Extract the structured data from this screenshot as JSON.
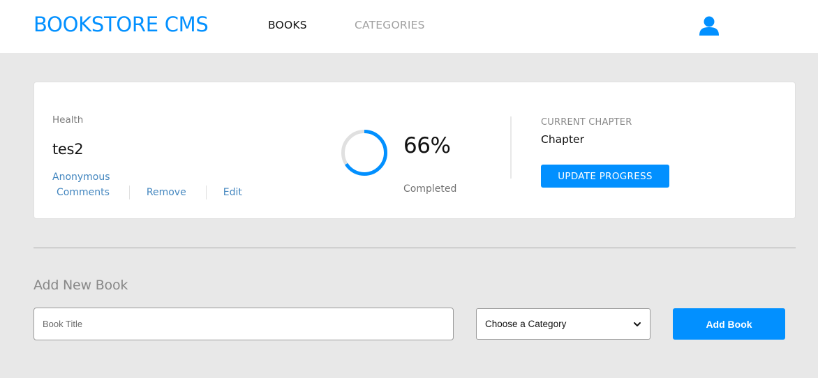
{
  "header": {
    "brand": "BOOKSTORE CMS",
    "nav": {
      "books": "BOOKS",
      "categories": "CATEGORIES"
    },
    "user_icon": "user-icon"
  },
  "book": {
    "genre": "Health",
    "title": "tes2",
    "author": "Anonymous",
    "actions": {
      "comments": "Comments",
      "remove": "Remove",
      "edit": "Edit"
    },
    "progress_value": 0.66,
    "percent_text": "66%",
    "completed_label": "Completed",
    "chapter_label": "CURRENT CHAPTER",
    "chapter": "Chapter",
    "update_button": "UPDATE PROGRESS"
  },
  "form": {
    "title": "Add New Book",
    "title_placeholder": "Book Title",
    "category_selected": "Choose a Category",
    "add_button": "Add Book"
  },
  "colors": {
    "accent": "#0290ff",
    "link": "#4386bf",
    "background": "#e8e8e8",
    "ring_track": "#e0e0e0"
  }
}
